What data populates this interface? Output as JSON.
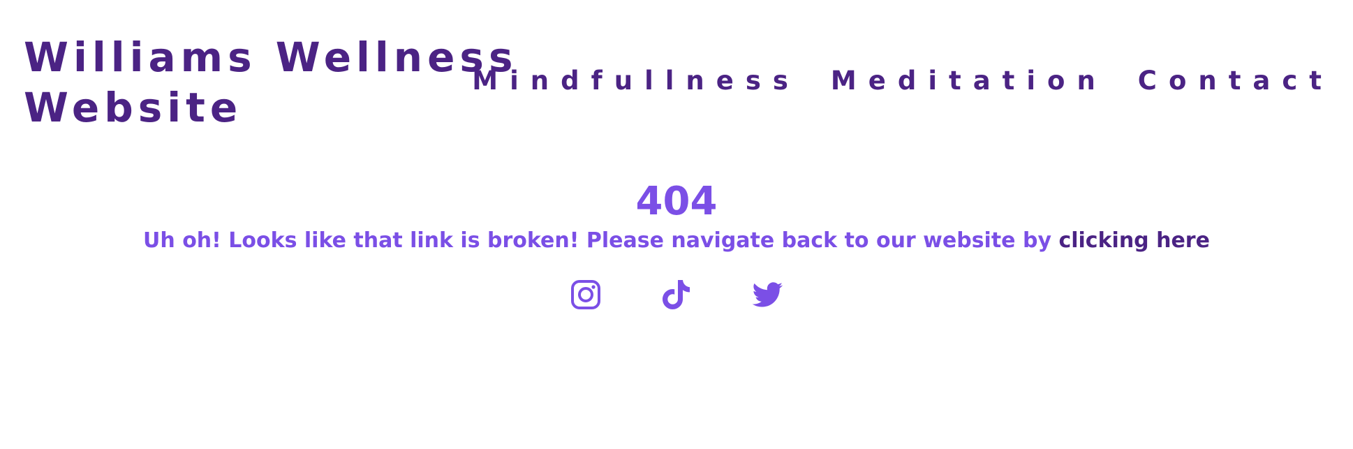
{
  "header": {
    "site_title": "Williams Wellness Website",
    "nav": [
      {
        "label": "Mindfullness"
      },
      {
        "label": "Meditation"
      },
      {
        "label": "Contact"
      }
    ]
  },
  "main": {
    "error_code": "404",
    "message_prefix": "Uh oh! Looks like that link is broken! Please navigate back to our website by ",
    "link_text": "clicking here"
  },
  "social": [
    {
      "icon": "instagram-icon"
    },
    {
      "icon": "tiktok-icon"
    },
    {
      "icon": "twitter-icon"
    }
  ],
  "colors": {
    "title": "#4b2384",
    "accent": "#7b4fe6",
    "link": "#4b2384",
    "background": "#ffffff"
  }
}
